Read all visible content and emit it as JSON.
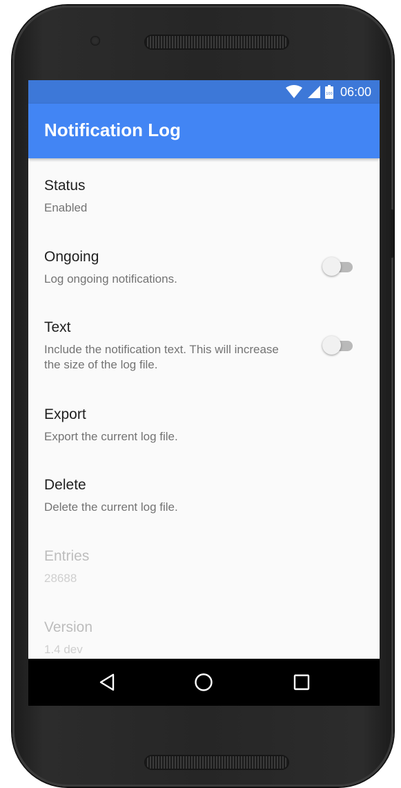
{
  "status_bar": {
    "time": "06:00",
    "battery_level_label": "100",
    "icons": [
      "wifi-icon",
      "cell-signal-icon",
      "battery-icon"
    ]
  },
  "app_bar": {
    "title": "Notification Log",
    "color": "#4285f4",
    "status_color": "#3d78d8"
  },
  "preferences": [
    {
      "title": "Status",
      "summary": "Enabled",
      "enabled": true,
      "has_switch": false
    },
    {
      "title": "Ongoing",
      "summary": "Log ongoing notifications.",
      "enabled": true,
      "has_switch": true,
      "checked": false
    },
    {
      "title": "Text",
      "summary": "Include the notification text. This will increase the size of the log file.",
      "enabled": true,
      "has_switch": true,
      "checked": false
    },
    {
      "title": "Export",
      "summary": "Export the current log file.",
      "enabled": true,
      "has_switch": false
    },
    {
      "title": "Delete",
      "summary": "Delete the current log file.",
      "enabled": true,
      "has_switch": false
    },
    {
      "title": "Entries",
      "summary": "28688",
      "enabled": false,
      "has_switch": false
    },
    {
      "title": "Version",
      "summary": "1.4 dev",
      "enabled": false,
      "has_switch": false
    }
  ],
  "nav_bar": {
    "buttons": [
      "back-icon",
      "home-icon",
      "recents-icon"
    ]
  }
}
